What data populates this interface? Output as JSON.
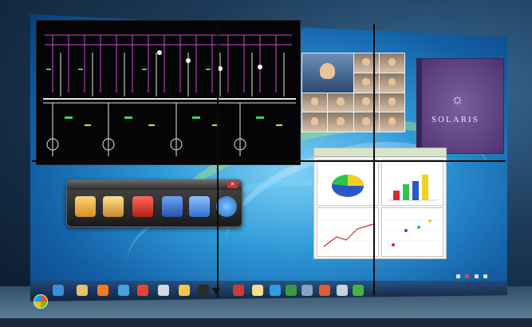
{
  "solaris": {
    "logo_glyph": "☼",
    "brand_text": "SOLARIS"
  },
  "toolbar": {
    "close_glyph": "✕",
    "buttons": [
      {
        "name": "folder-download-icon",
        "color": "#e8b24a"
      },
      {
        "name": "folder-upload-icon",
        "color": "#e8b24a"
      },
      {
        "name": "delete-icon",
        "color": "#d73a2e"
      },
      {
        "name": "layout-icon",
        "color": "#3b7bd6"
      },
      {
        "name": "screen-switch-icon",
        "color": "#4c93e0"
      },
      {
        "name": "help-icon",
        "color": "#3a8fe0"
      }
    ]
  },
  "colors": {
    "desktop_blue": "#2f9ad8",
    "scada_background": "#050508",
    "solaris_purple": "#6a4a90",
    "taskbar": "#1e3a5e"
  }
}
